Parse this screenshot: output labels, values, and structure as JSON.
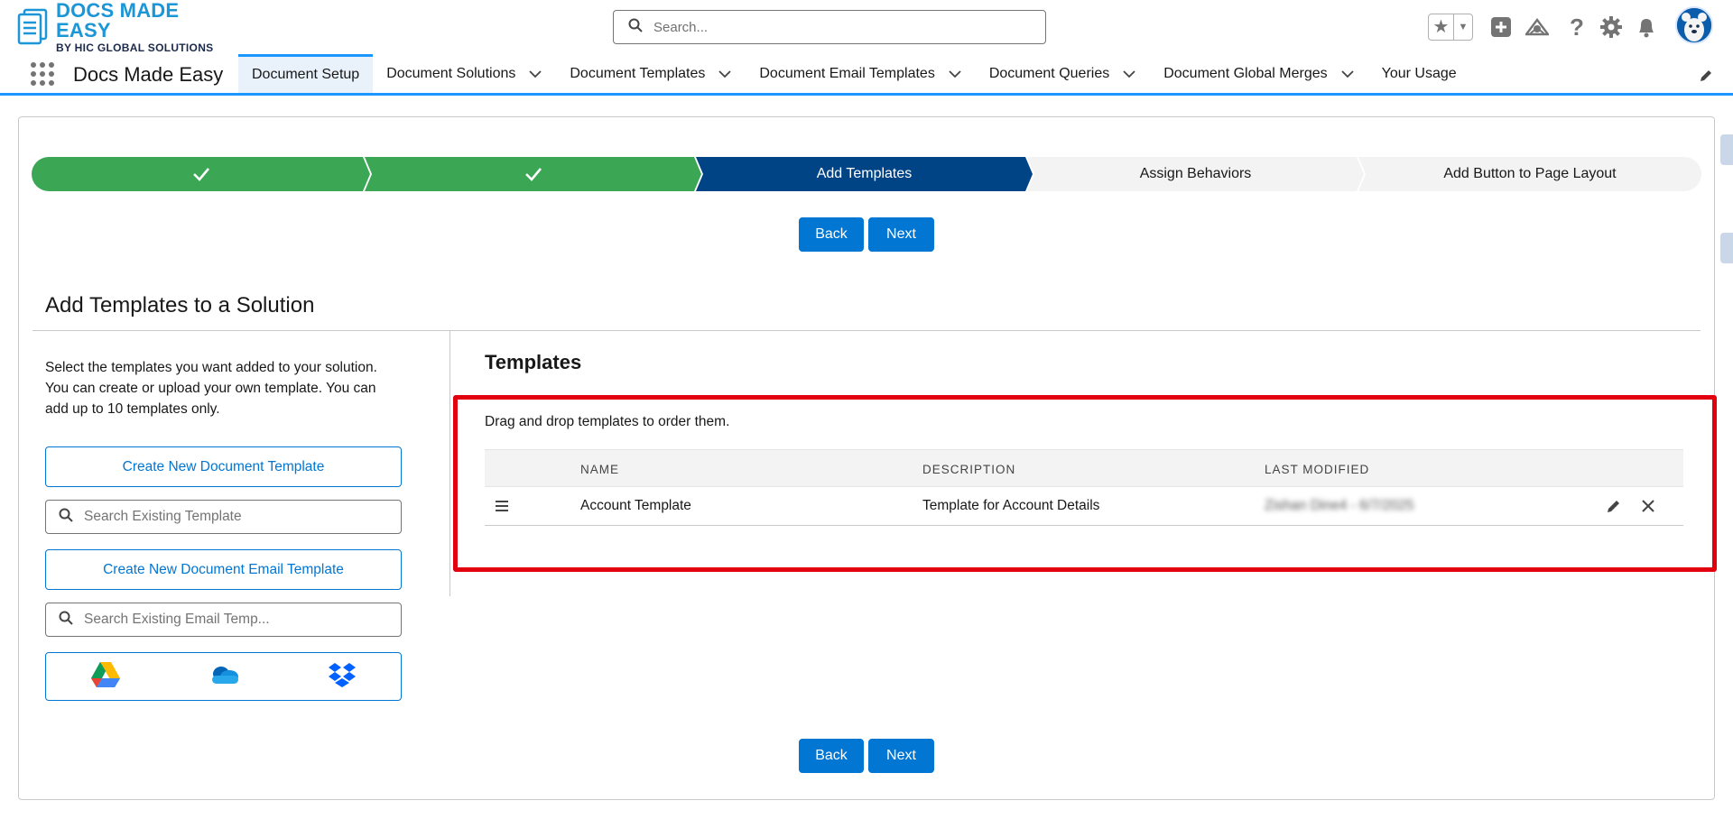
{
  "header": {
    "logo_main": "DOCS MADE EASY",
    "logo_sub": "BY HIC GLOBAL SOLUTIONS",
    "search_placeholder": "Search...",
    "icons": [
      "favorites-star-icon",
      "add-icon",
      "trailhead-icon",
      "help-icon",
      "setup-gear-icon",
      "notifications-bell-icon",
      "user-avatar"
    ]
  },
  "nav": {
    "app_name": "Docs Made Easy",
    "items": [
      {
        "label": "Document Setup",
        "active": true,
        "dropdown": false
      },
      {
        "label": "Document Solutions",
        "active": false,
        "dropdown": true
      },
      {
        "label": "Document Templates",
        "active": false,
        "dropdown": true
      },
      {
        "label": "Document Email Templates",
        "active": false,
        "dropdown": true
      },
      {
        "label": "Document Queries",
        "active": false,
        "dropdown": true
      },
      {
        "label": "Document Global Merges",
        "active": false,
        "dropdown": true
      },
      {
        "label": "Your Usage",
        "active": false,
        "dropdown": false
      }
    ]
  },
  "path": {
    "steps": [
      {
        "label": "",
        "state": "done"
      },
      {
        "label": "",
        "state": "done"
      },
      {
        "label": "Add Templates",
        "state": "current"
      },
      {
        "label": "Assign Behaviors",
        "state": "todo"
      },
      {
        "label": "Add Button to Page Layout",
        "state": "todo"
      }
    ]
  },
  "buttons": {
    "back": "Back",
    "next": "Next"
  },
  "left_panel": {
    "title": "Add Templates to a Solution",
    "help_text": "Select the templates you want added to your solution. You can create or upload your own template. You can add up to 10 templates only.",
    "create_template": "Create New Document Template",
    "search_template_placeholder": "Search Existing Template",
    "create_email_template": "Create New Document Email Template",
    "search_email_placeholder": "Search Existing Email Temp...",
    "cloud_sources": [
      "google-drive-icon",
      "onedrive-icon",
      "dropbox-icon"
    ]
  },
  "templates": {
    "title": "Templates",
    "instructions": "Drag and drop templates to order them.",
    "columns": [
      "NAME",
      "DESCRIPTION",
      "LAST MODIFIED"
    ],
    "rows": [
      {
        "name": "Account Template",
        "description": "Template for Account Details",
        "last_modified": "Zishan Dine4 - 6/7/2025"
      }
    ]
  },
  "colors": {
    "brand_blue": "#0176d3",
    "path_done": "#3ba755",
    "path_current": "#014486",
    "highlight_red": "#e3000e"
  }
}
